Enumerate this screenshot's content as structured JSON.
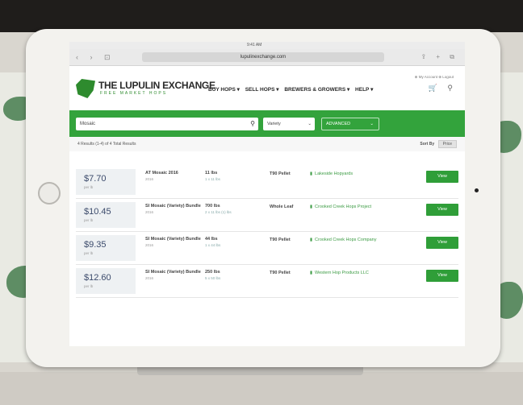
{
  "colors": {
    "brand_green": "#33a33c",
    "price_blue": "#3b4a6b"
  },
  "browser": {
    "time": "9:41 AM",
    "url": "lupulinexchange.com",
    "nav_icons": "‹ › ⊡",
    "action_icons": "⇪ + ⧉"
  },
  "header": {
    "logo_name": "THE LUPULIN EXCHANGE",
    "logo_tag": "FREE MARKET HOPS",
    "nav": [
      "BUY HOPS ▾",
      "SELL HOPS ▾",
      "BREWERS & GROWERS ▾",
      "HELP ▾"
    ],
    "top_links": "⊕ My Account  ⊕ Logout",
    "icons": "🛒 ⚲"
  },
  "search": {
    "input_value": "Mosaic",
    "search_icon": "search-icon",
    "select_value": "Variety",
    "advanced_label": "ADVANCED",
    "chevron": "⌄"
  },
  "results": {
    "summary": "4 Results  (1-4)  of 4 Total Results",
    "sort_label": "Sort By",
    "sort_value": "Price"
  },
  "listings": [
    {
      "price": "$7.70",
      "unit": "per lb",
      "variety": "AT Mosaic 2016",
      "variety_sub": "2016",
      "qty": "11 lbs",
      "qty_sub": "1 x 11 lbs",
      "form": "T90 Pellet",
      "seller": "Lakeside Hopyards",
      "action": "View"
    },
    {
      "price": "$10.45",
      "unit": "per lb",
      "variety": "SI Mosaic (Variety) Bundle",
      "variety_sub": "2016",
      "qty": "700 lbs",
      "qty_sub": "2 x 11 lbs (1) lbs",
      "form": "Whole Leaf",
      "seller": "Crooked Creek Hops Project",
      "action": "View"
    },
    {
      "price": "$9.35",
      "unit": "per lb",
      "variety": "SI Mosaic (Variety) Bundle",
      "variety_sub": "2016",
      "qty": "44 lbs",
      "qty_sub": "1 x 44 lbs",
      "form": "T90 Pellet",
      "seller": "Crooked Creek Hops Company",
      "action": "View"
    },
    {
      "price": "$12.60",
      "unit": "per lb",
      "variety": "SI Mosaic (Variety) Bundle",
      "variety_sub": "2016",
      "qty": "250 lbs",
      "qty_sub": "5 x 50 lbs",
      "form": "T90 Pellet",
      "seller": "Western Hop Products LLC",
      "action": "View"
    }
  ]
}
